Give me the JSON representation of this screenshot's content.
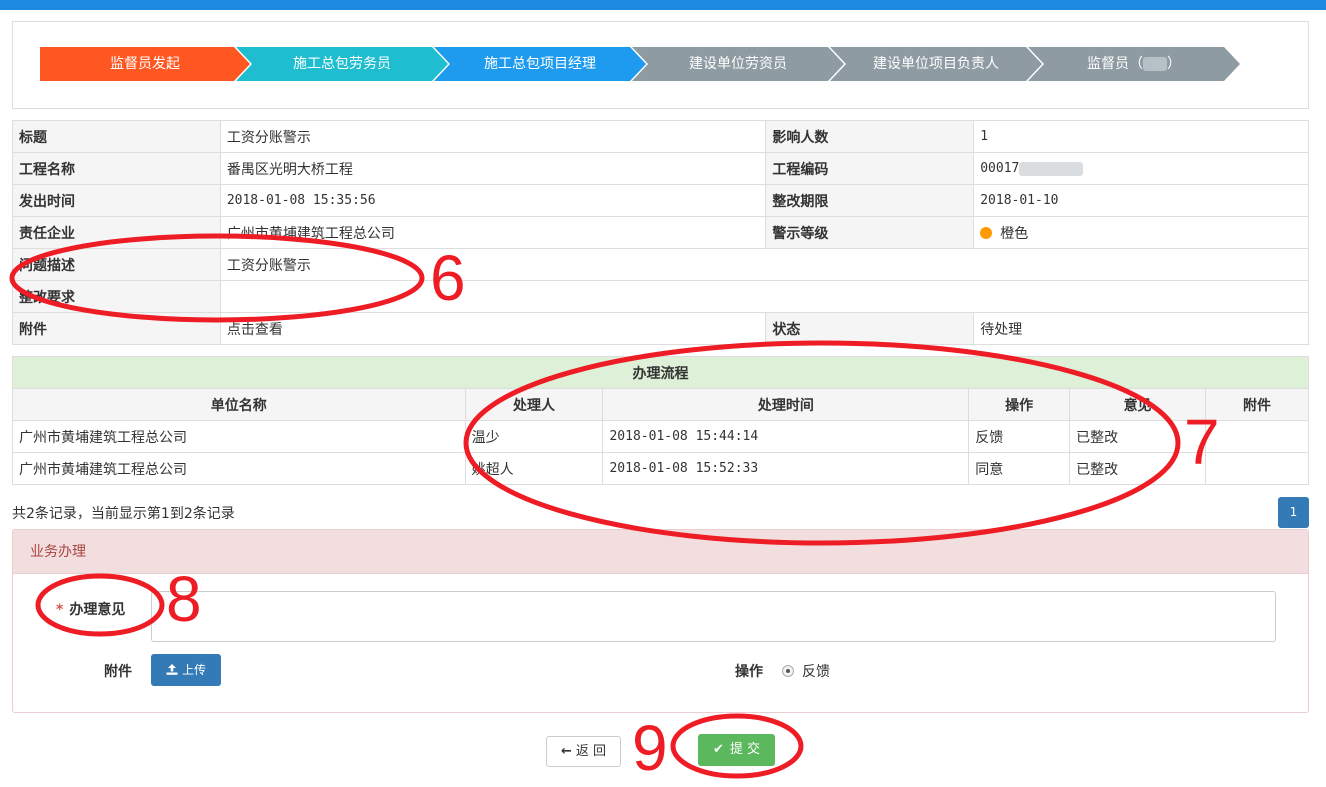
{
  "workflow": {
    "steps": [
      "监督员发起",
      "施工总包劳务员",
      "施工总包项目经理",
      "建设单位劳资员",
      "建设单位项目负责人",
      "监督员（"
    ],
    "last_suffix": "）"
  },
  "info": {
    "title_label": "标题",
    "title_value": "工资分账警示",
    "affected_label": "影响人数",
    "affected_value": "1",
    "project_name_label": "工程名称",
    "project_name_value": "番禺区光明大桥工程",
    "project_code_label": "工程编码",
    "project_code_value": "00017",
    "issued_label": "发出时间",
    "issued_value": "2018-01-08 15:35:56",
    "deadline_label": "整改期限",
    "deadline_value": "2018-01-10",
    "company_label": "责任企业",
    "company_value": "广州市黄埔建筑工程总公司",
    "level_label": "警示等级",
    "level_value": "橙色",
    "problem_label": "问题描述",
    "problem_value": "工资分账警示",
    "requirement_label": "整改要求",
    "requirement_value": "",
    "attachment_label": "附件",
    "attachment_value": "点击查看",
    "status_label": "状态",
    "status_value": "待处理"
  },
  "process": {
    "caption": "办理流程",
    "headers": [
      "单位名称",
      "处理人",
      "处理时间",
      "操作",
      "意见",
      "附件"
    ],
    "rows": [
      [
        "广州市黄埔建筑工程总公司",
        "温少",
        "2018-01-08 15:44:14",
        "反馈",
        "已整改",
        ""
      ],
      [
        "广州市黄埔建筑工程总公司",
        "姚超人",
        "2018-01-08 15:52:33",
        "同意",
        "已整改",
        ""
      ]
    ]
  },
  "records_text": "共2条记录，当前显示第1到2条记录",
  "pager_page": "1",
  "panel": {
    "title": "业务办理",
    "required_mark": "*",
    "opinion_label": "办理意见",
    "attachment_label": "附件",
    "upload_label": "上传",
    "operation_label": "操作",
    "operation_option": "反馈"
  },
  "buttons": {
    "back": "返 回",
    "submit": "提 交"
  },
  "annotations": {
    "n6": "6",
    "n7": "7",
    "n8": "8",
    "n9": "9"
  },
  "colors": {
    "accent": "#1d8ce0",
    "step_active": "#ff5722",
    "annotation": "#ee1c24",
    "level_orange": "#ff9900"
  }
}
